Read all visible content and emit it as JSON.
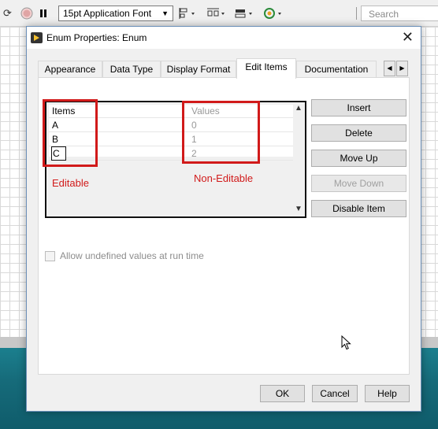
{
  "toolbar": {
    "font_select": "15pt Application Font",
    "search_placeholder": "Search",
    "icons": [
      "run-continuously-icon",
      "abort-icon",
      "pause-icon",
      "align-objects-icon",
      "distribute-objects-icon",
      "resize-objects-icon",
      "reorder-icon"
    ]
  },
  "dialog": {
    "title": "Enum Properties: Enum",
    "tabs": [
      {
        "label": "Appearance"
      },
      {
        "label": "Data Type"
      },
      {
        "label": "Display Format"
      },
      {
        "label": "Edit Items"
      },
      {
        "label": "Documentation"
      }
    ],
    "active_tab": "Edit Items",
    "list": {
      "header_items": "Items",
      "header_values": "Values",
      "rows": [
        {
          "item": "A",
          "value": "0"
        },
        {
          "item": "B",
          "value": "1"
        },
        {
          "item": "C",
          "value": "2"
        }
      ]
    },
    "annotations": {
      "editable": "Editable",
      "non_editable": "Non-Editable"
    },
    "buttons": {
      "insert": "Insert",
      "delete": "Delete",
      "move_up": "Move Up",
      "move_down": "Move Down",
      "disable_item": "Disable Item"
    },
    "checkbox_label": "Allow undefined values at run time",
    "checkbox_checked": false,
    "footer": {
      "ok": "OK",
      "cancel": "Cancel",
      "help": "Help"
    }
  },
  "colors": {
    "annotation_red": "#d11a1a",
    "desktop_teal": "#166b7a"
  }
}
